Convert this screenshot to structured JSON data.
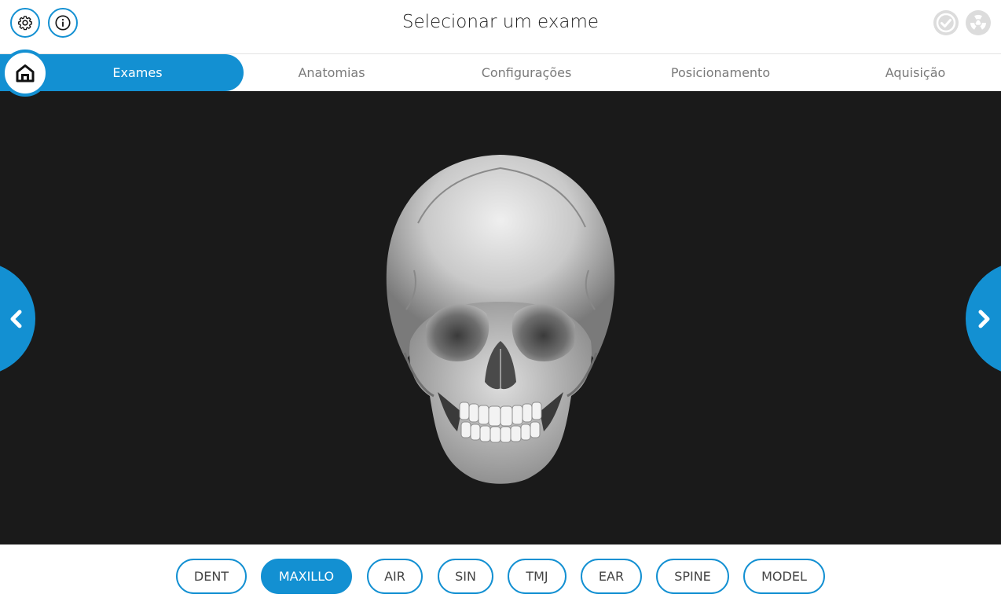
{
  "header": {
    "title": "Selecionar um exame",
    "settings_icon": "gear-icon",
    "info_icon": "info-icon",
    "status_icons": [
      "check-circle-icon",
      "radiation-icon"
    ]
  },
  "tabs": [
    {
      "label": "Exames",
      "active": true
    },
    {
      "label": "Anatomias",
      "active": false
    },
    {
      "label": "Configurações",
      "active": false
    },
    {
      "label": "Posicionamento",
      "active": false
    },
    {
      "label": "Aquisição",
      "active": false
    }
  ],
  "viewer": {
    "image": "skull-3d-frontal-view",
    "prev_icon": "chevron-left-icon",
    "next_icon": "chevron-right-icon"
  },
  "exam_types": [
    {
      "label": "DENT",
      "active": false
    },
    {
      "label": "MAXILLO",
      "active": true
    },
    {
      "label": "AIR",
      "active": false
    },
    {
      "label": "SIN",
      "active": false
    },
    {
      "label": "TMJ",
      "active": false
    },
    {
      "label": "EAR",
      "active": false
    },
    {
      "label": "SPINE",
      "active": false
    },
    {
      "label": "MODEL",
      "active": false
    }
  ],
  "colors": {
    "accent": "#1390d2",
    "viewer_bg": "#1a1a1a",
    "status_icon": "#dcdcdc"
  }
}
